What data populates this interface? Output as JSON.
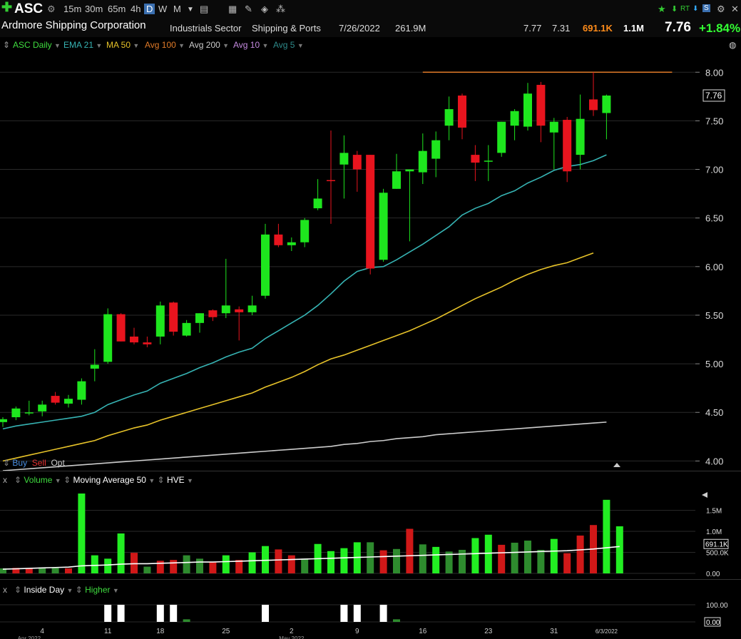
{
  "toolbar": {
    "symbol": "ASC",
    "intervals": [
      "15m",
      "30m",
      "65m",
      "4h",
      "D",
      "W",
      "M"
    ],
    "active_interval": "D",
    "right_labels": [
      "RT",
      "S"
    ]
  },
  "info": {
    "company": "Ardmore Shipping Corporation",
    "sector": "Industrials Sector",
    "industry": "Shipping & Ports",
    "date": "7/26/2022",
    "market_cap": "261.9M",
    "high": "7.77",
    "low": "7.31",
    "volume": "691.1K",
    "avg_volume": "1.1M",
    "last": "7.76",
    "change": "+1.84%"
  },
  "studies": {
    "main": [
      {
        "label": "ASC Daily",
        "color": "#3fdc3f"
      },
      {
        "label": "EMA 21",
        "color": "#36b3b3"
      },
      {
        "label": "MA 50",
        "color": "#e6c229"
      },
      {
        "label": "Avg 100",
        "color": "#e07a28"
      },
      {
        "label": "Avg 200",
        "color": "#cccccc"
      },
      {
        "label": "Avg 10",
        "color": "#c58ae0"
      },
      {
        "label": "Avg 5",
        "color": "#2e8a8a"
      }
    ],
    "trade_buttons": [
      "Buy",
      "Sell",
      "Opt"
    ],
    "volume_pane": [
      "Volume",
      "Moving Average 50",
      "HVE"
    ],
    "indicator_pane": [
      "Inside Day",
      "Higher"
    ],
    "close_x": "x"
  },
  "chart_data": [
    {
      "type": "candlestick",
      "title": "ASC Daily",
      "ylim": [
        3.9,
        8.2
      ],
      "y_ticks": [
        4.0,
        4.5,
        5.0,
        5.5,
        6.0,
        6.5,
        7.0,
        7.5,
        8.0
      ],
      "y_tick_labels": [
        "4.00",
        "4.50",
        "5.00",
        "5.50",
        "6.00",
        "6.50",
        "7.00",
        "7.50",
        "8.00"
      ],
      "last_price_label": "7.76",
      "resistance_level": 8.0,
      "x_tick_labels": [
        "4",
        "11",
        "18",
        "25",
        "2",
        "9",
        "16",
        "23",
        "31",
        "6/3/2022"
      ],
      "x_tick_candle_index": [
        3,
        8,
        12,
        17,
        22,
        27,
        32,
        37,
        42,
        46
      ],
      "x_sub_labels": [
        "Apr 2022",
        "May 2022"
      ],
      "x_sub_label_index": [
        2,
        22
      ],
      "candles": [
        {
          "o": 4.4,
          "h": 4.45,
          "l": 4.35,
          "c": 4.43
        },
        {
          "o": 4.45,
          "h": 4.56,
          "l": 4.42,
          "c": 4.54
        },
        {
          "o": 4.49,
          "h": 4.62,
          "l": 4.47,
          "c": 4.5
        },
        {
          "o": 4.51,
          "h": 4.62,
          "l": 4.46,
          "c": 4.58
        },
        {
          "o": 4.67,
          "h": 4.71,
          "l": 4.58,
          "c": 4.6
        },
        {
          "o": 4.59,
          "h": 4.68,
          "l": 4.55,
          "c": 4.64
        },
        {
          "o": 4.63,
          "h": 4.85,
          "l": 4.58,
          "c": 4.82
        },
        {
          "o": 4.95,
          "h": 5.15,
          "l": 4.82,
          "c": 4.99
        },
        {
          "o": 5.02,
          "h": 5.57,
          "l": 5.0,
          "c": 5.51
        },
        {
          "o": 5.51,
          "h": 5.52,
          "l": 5.23,
          "c": 5.23
        },
        {
          "o": 5.28,
          "h": 5.37,
          "l": 5.2,
          "c": 5.22
        },
        {
          "o": 5.22,
          "h": 5.28,
          "l": 5.17,
          "c": 5.2
        },
        {
          "o": 5.28,
          "h": 5.64,
          "l": 5.2,
          "c": 5.6
        },
        {
          "o": 5.63,
          "h": 5.64,
          "l": 5.29,
          "c": 5.33
        },
        {
          "o": 5.29,
          "h": 5.45,
          "l": 5.28,
          "c": 5.42
        },
        {
          "o": 5.42,
          "h": 5.52,
          "l": 5.32,
          "c": 5.52
        },
        {
          "o": 5.55,
          "h": 5.56,
          "l": 5.44,
          "c": 5.48
        },
        {
          "o": 5.52,
          "h": 6.08,
          "l": 5.47,
          "c": 5.6
        },
        {
          "o": 5.56,
          "h": 5.59,
          "l": 5.24,
          "c": 5.53
        },
        {
          "o": 5.53,
          "h": 5.7,
          "l": 5.5,
          "c": 5.6
        },
        {
          "o": 5.7,
          "h": 6.44,
          "l": 5.67,
          "c": 6.33
        },
        {
          "o": 6.33,
          "h": 6.44,
          "l": 6.2,
          "c": 6.22
        },
        {
          "o": 6.22,
          "h": 6.3,
          "l": 6.16,
          "c": 6.25
        },
        {
          "o": 6.25,
          "h": 6.5,
          "l": 6.2,
          "c": 6.48
        },
        {
          "o": 6.6,
          "h": 6.9,
          "l": 6.58,
          "c": 6.7
        },
        {
          "o": 6.89,
          "h": 7.4,
          "l": 6.44,
          "c": 6.88
        },
        {
          "o": 7.05,
          "h": 7.35,
          "l": 6.7,
          "c": 7.17
        },
        {
          "o": 7.15,
          "h": 7.19,
          "l": 6.77,
          "c": 7.0
        },
        {
          "o": 7.15,
          "h": 7.15,
          "l": 5.92,
          "c": 5.98
        },
        {
          "o": 6.07,
          "h": 6.8,
          "l": 6.05,
          "c": 6.76
        },
        {
          "o": 6.8,
          "h": 7.16,
          "l": 6.8,
          "c": 6.98
        },
        {
          "o": 6.98,
          "h": 7.0,
          "l": 6.26,
          "c": 7.0
        },
        {
          "o": 6.97,
          "h": 7.37,
          "l": 6.85,
          "c": 7.19
        },
        {
          "o": 7.11,
          "h": 7.39,
          "l": 6.92,
          "c": 7.3
        },
        {
          "o": 7.45,
          "h": 7.75,
          "l": 7.3,
          "c": 7.62
        },
        {
          "o": 7.76,
          "h": 7.78,
          "l": 7.31,
          "c": 7.43
        },
        {
          "o": 7.15,
          "h": 7.25,
          "l": 6.88,
          "c": 7.07
        },
        {
          "o": 7.09,
          "h": 7.25,
          "l": 6.88,
          "c": 7.09
        },
        {
          "o": 7.17,
          "h": 7.49,
          "l": 7.13,
          "c": 7.49
        },
        {
          "o": 7.45,
          "h": 7.62,
          "l": 7.3,
          "c": 7.6
        },
        {
          "o": 7.44,
          "h": 7.89,
          "l": 7.4,
          "c": 7.78
        },
        {
          "o": 7.87,
          "h": 7.9,
          "l": 7.28,
          "c": 7.45
        },
        {
          "o": 7.38,
          "h": 7.53,
          "l": 7.0,
          "c": 7.49
        },
        {
          "o": 7.51,
          "h": 7.54,
          "l": 6.87,
          "c": 6.98
        },
        {
          "o": 7.15,
          "h": 7.77,
          "l": 7.0,
          "c": 7.52
        },
        {
          "o": 7.72,
          "h": 8.0,
          "l": 7.55,
          "c": 7.61
        },
        {
          "o": 7.58,
          "h": 7.77,
          "l": 7.31,
          "c": 7.76
        }
      ],
      "ema21": [
        4.33,
        4.36,
        4.38,
        4.4,
        4.42,
        4.44,
        4.46,
        4.5,
        4.58,
        4.63,
        4.68,
        4.72,
        4.8,
        4.85,
        4.9,
        4.96,
        5.01,
        5.07,
        5.12,
        5.16,
        5.26,
        5.34,
        5.42,
        5.5,
        5.6,
        5.72,
        5.85,
        5.95,
        5.99,
        6.0,
        6.07,
        6.15,
        6.23,
        6.32,
        6.41,
        6.53,
        6.6,
        6.65,
        6.73,
        6.78,
        6.86,
        6.92,
        6.99,
        7.03,
        7.05,
        7.09,
        7.15
      ],
      "ma50": [
        4.0,
        4.03,
        4.06,
        4.09,
        4.12,
        4.15,
        4.18,
        4.21,
        4.26,
        4.3,
        4.34,
        4.37,
        4.42,
        4.46,
        4.5,
        4.54,
        4.58,
        4.62,
        4.66,
        4.7,
        4.76,
        4.81,
        4.86,
        4.92,
        4.99,
        5.05,
        5.09,
        5.14,
        5.19,
        5.24,
        5.29,
        5.34,
        5.4,
        5.46,
        5.53,
        5.6,
        5.67,
        5.73,
        5.79,
        5.86,
        5.92,
        5.97,
        6.01,
        6.04,
        6.09,
        6.14
      ],
      "ma200": [
        3.9,
        3.91,
        3.92,
        3.93,
        3.94,
        3.95,
        3.96,
        3.97,
        3.98,
        3.99,
        4.0,
        4.01,
        4.02,
        4.03,
        4.04,
        4.05,
        4.06,
        4.07,
        4.08,
        4.09,
        4.1,
        4.11,
        4.12,
        4.13,
        4.14,
        4.15,
        4.17,
        4.18,
        4.2,
        4.21,
        4.23,
        4.24,
        4.25,
        4.27,
        4.28,
        4.29,
        4.3,
        4.31,
        4.32,
        4.33,
        4.34,
        4.35,
        4.36,
        4.37,
        4.38,
        4.39,
        4.4
      ]
    },
    {
      "type": "bar",
      "title": "Volume",
      "ylim": [
        0,
        1900000
      ],
      "y_tick_labels": [
        "0.00",
        "500.0K",
        "1.0M",
        "1.5M"
      ],
      "y_ticks": [
        0,
        500000,
        1000000,
        1500000
      ],
      "last_volume_label": "691.1K",
      "values": [
        120000,
        130000,
        120000,
        140000,
        130000,
        120000,
        1900000,
        430000,
        350000,
        950000,
        490000,
        160000,
        300000,
        320000,
        430000,
        350000,
        260000,
        430000,
        320000,
        500000,
        650000,
        570000,
        430000,
        350000,
        700000,
        530000,
        600000,
        740000,
        740000,
        550000,
        580000,
        1060000,
        690000,
        630000,
        520000,
        560000,
        840000,
        920000,
        680000,
        730000,
        780000,
        560000,
        820000,
        480000,
        900000,
        1150000,
        1750000,
        1120000
      ],
      "colors": [
        "dark",
        "red",
        "red",
        "dark",
        "dark",
        "red",
        "bright",
        "bright",
        "bright",
        "bright",
        "red",
        "dark",
        "red",
        "red",
        "dark",
        "dark",
        "red",
        "bright",
        "red",
        "bright",
        "bright",
        "red",
        "red",
        "dark",
        "bright",
        "bright",
        "bright",
        "bright",
        "dark",
        "red",
        "dark",
        "red",
        "dark",
        "bright",
        "dark",
        "dark",
        "bright",
        "bright",
        "red",
        "dark",
        "dark",
        "dark",
        "bright",
        "red",
        "red",
        "red",
        "bright",
        "bright",
        "dark"
      ],
      "ma50": [
        100000,
        110000,
        120000,
        130000,
        140000,
        150000,
        180000,
        190000,
        200000,
        220000,
        230000,
        230000,
        240000,
        250000,
        260000,
        270000,
        270000,
        280000,
        290000,
        300000,
        310000,
        320000,
        330000,
        340000,
        350000,
        360000,
        370000,
        380000,
        390000,
        400000,
        410000,
        420000,
        430000,
        440000,
        450000,
        460000,
        470000,
        480000,
        490000,
        500000,
        510000,
        520000,
        530000,
        540000,
        560000,
        580000,
        610000,
        640000
      ]
    },
    {
      "type": "bar",
      "title": "Inside Day",
      "y_tick_labels": [
        "0.00",
        "100.00"
      ],
      "ylim": [
        0,
        100
      ],
      "values": [
        0,
        0,
        0,
        0,
        0,
        0,
        0,
        0,
        100,
        100,
        0,
        0,
        100,
        100,
        15,
        0,
        0,
        0,
        0,
        0,
        100,
        0,
        0,
        0,
        0,
        0,
        100,
        100,
        0,
        100,
        15,
        0,
        0,
        0,
        0,
        0,
        0,
        0,
        0,
        0,
        0,
        0,
        0,
        0,
        0,
        0,
        0,
        0
      ],
      "colors": [
        "none",
        "none",
        "none",
        "none",
        "none",
        "none",
        "none",
        "none",
        "white",
        "white",
        "none",
        "none",
        "white",
        "white",
        "green",
        "none",
        "none",
        "none",
        "none",
        "none",
        "white",
        "none",
        "none",
        "none",
        "none",
        "none",
        "white",
        "white",
        "none",
        "white",
        "green",
        "none",
        "none",
        "none",
        "none",
        "none",
        "none",
        "none",
        "none",
        "none",
        "none",
        "none",
        "none",
        "none",
        "none",
        "none",
        "none",
        "none"
      ]
    }
  ]
}
